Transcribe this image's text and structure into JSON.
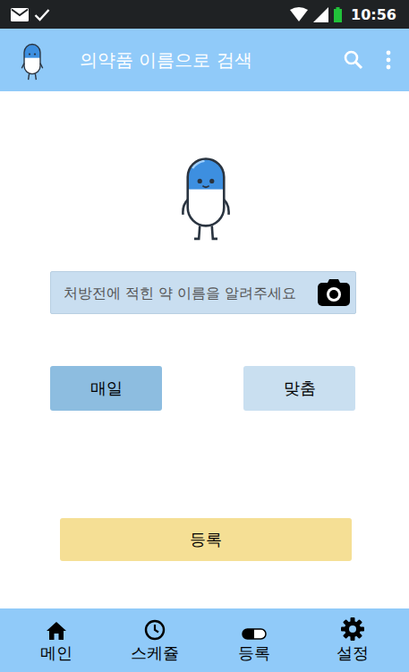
{
  "status_bar": {
    "time": "10:56",
    "battery": {
      "level": 1
    }
  },
  "app_bar": {
    "title": "의약품 이름으로 검색"
  },
  "search": {
    "placeholder": "처방전에 적힌 약 이름을 알려주세요"
  },
  "modes": [
    {
      "label": "매일",
      "selected": true
    },
    {
      "label": "맞춤",
      "selected": false
    }
  ],
  "submit": {
    "label": "등록"
  },
  "nav": [
    {
      "label": "메인"
    },
    {
      "label": "스케쥴"
    },
    {
      "label": "등록"
    },
    {
      "label": "설정"
    }
  ]
}
